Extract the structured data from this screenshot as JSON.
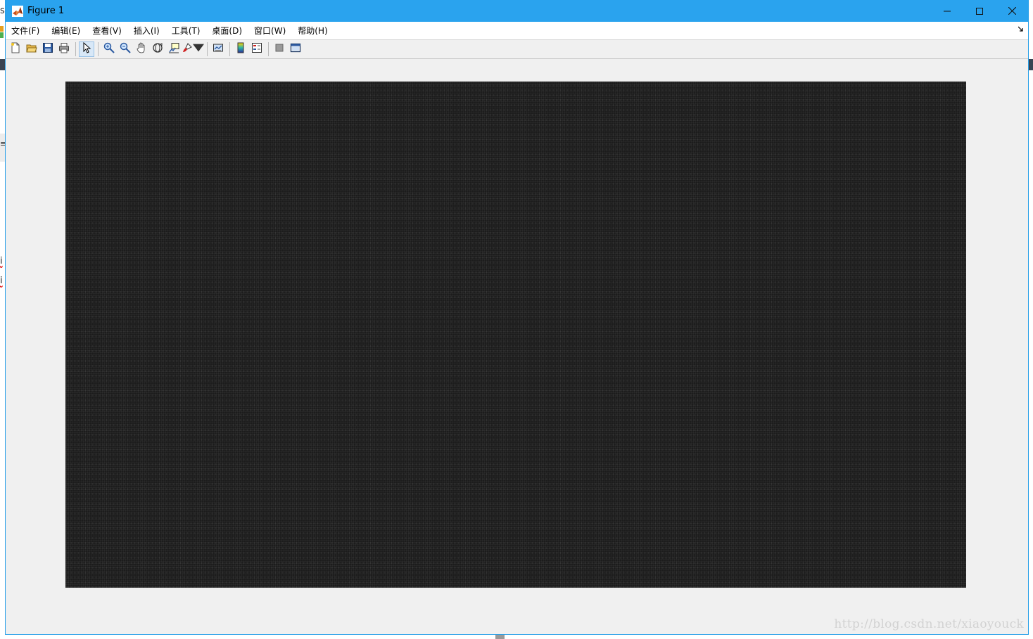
{
  "window": {
    "title": "Figure 1",
    "controls": {
      "minimize": "—",
      "maximize": "☐",
      "close": "✕"
    }
  },
  "menubar": {
    "items": [
      "文件(F)",
      "编辑(E)",
      "查看(V)",
      "插入(I)",
      "工具(T)",
      "桌面(D)",
      "窗口(W)",
      "帮助(H)"
    ]
  },
  "toolbar": {
    "buttons": [
      "new-figure-icon",
      "open-file-icon",
      "save-icon",
      "print-icon",
      "pointer-icon",
      "zoom-in-icon",
      "zoom-out-icon",
      "pan-hand-icon",
      "rotate-3d-icon",
      "data-cursor-icon",
      "brush-icon",
      "link-plot-icon",
      "insert-colorbar-icon",
      "insert-legend-icon",
      "hide-plot-tools-icon",
      "show-plot-tools-icon"
    ],
    "active": "pointer-icon"
  },
  "figure": {
    "image_color": "#1c1c1c"
  },
  "watermark": "http://blog.csdn.net/xiaoyouck",
  "background_app": {
    "fragments": [
      "s",
      "i",
      "i",
      "≡"
    ]
  },
  "colors": {
    "titlebar": "#2aa3ee",
    "window_border": "#29a0e8",
    "figure_bg": "#f0f0f0"
  }
}
